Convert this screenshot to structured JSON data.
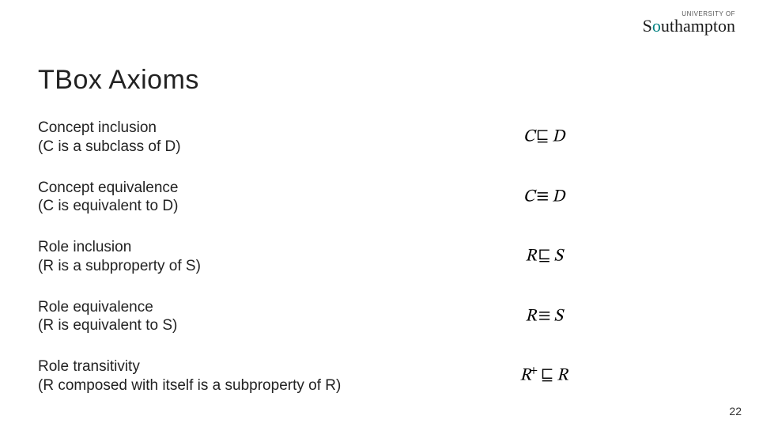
{
  "logo": {
    "prefix": "UNIVERSITY OF",
    "name_pre": "S",
    "name_accent": "o",
    "name_post": "uthampton"
  },
  "title": "TBox Axioms",
  "rows": [
    {
      "name": "Concept inclusion",
      "expl": "(C is a subclass of D)",
      "lhs": "C",
      "op": "⊑",
      "rhs": "D",
      "sup": ""
    },
    {
      "name": "Concept equivalence",
      "expl": "(C is equivalent to D)",
      "lhs": "C",
      "op": "≡",
      "rhs": "D",
      "sup": ""
    },
    {
      "name": "Role inclusion",
      "expl": "(R is a subproperty of S)",
      "lhs": "R",
      "op": "⊑",
      "rhs": "S",
      "sup": ""
    },
    {
      "name": "Role equivalence",
      "expl": "(R is equivalent to S)",
      "lhs": "R",
      "op": "≡",
      "rhs": "S",
      "sup": ""
    },
    {
      "name": "Role transitivity",
      "expl": "(R composed with itself is a subproperty of R)",
      "lhs": "R",
      "op": "⊑",
      "rhs": "R",
      "sup": "+"
    }
  ],
  "page_number": "22"
}
